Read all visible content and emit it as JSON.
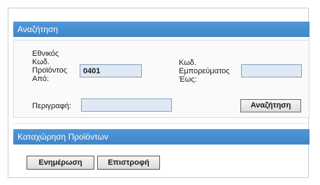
{
  "search": {
    "title": "Αναζήτηση",
    "national_code_label": [
      "Εθνικός",
      "Κωδ.",
      "Προϊόντος",
      "Από:"
    ],
    "national_code_value": "0401",
    "trade_code_label": [
      "Κωδ.",
      "Εμπορεύματος",
      "Έως:"
    ],
    "trade_code_value": "",
    "description_label": "Περιγραφή:",
    "description_value": "",
    "search_button": "Αναζήτηση"
  },
  "registration": {
    "title": "Καταχώρηση Προϊόντων",
    "update_button": "Ενημέρωση",
    "back_button": "Επιστροφή"
  }
}
